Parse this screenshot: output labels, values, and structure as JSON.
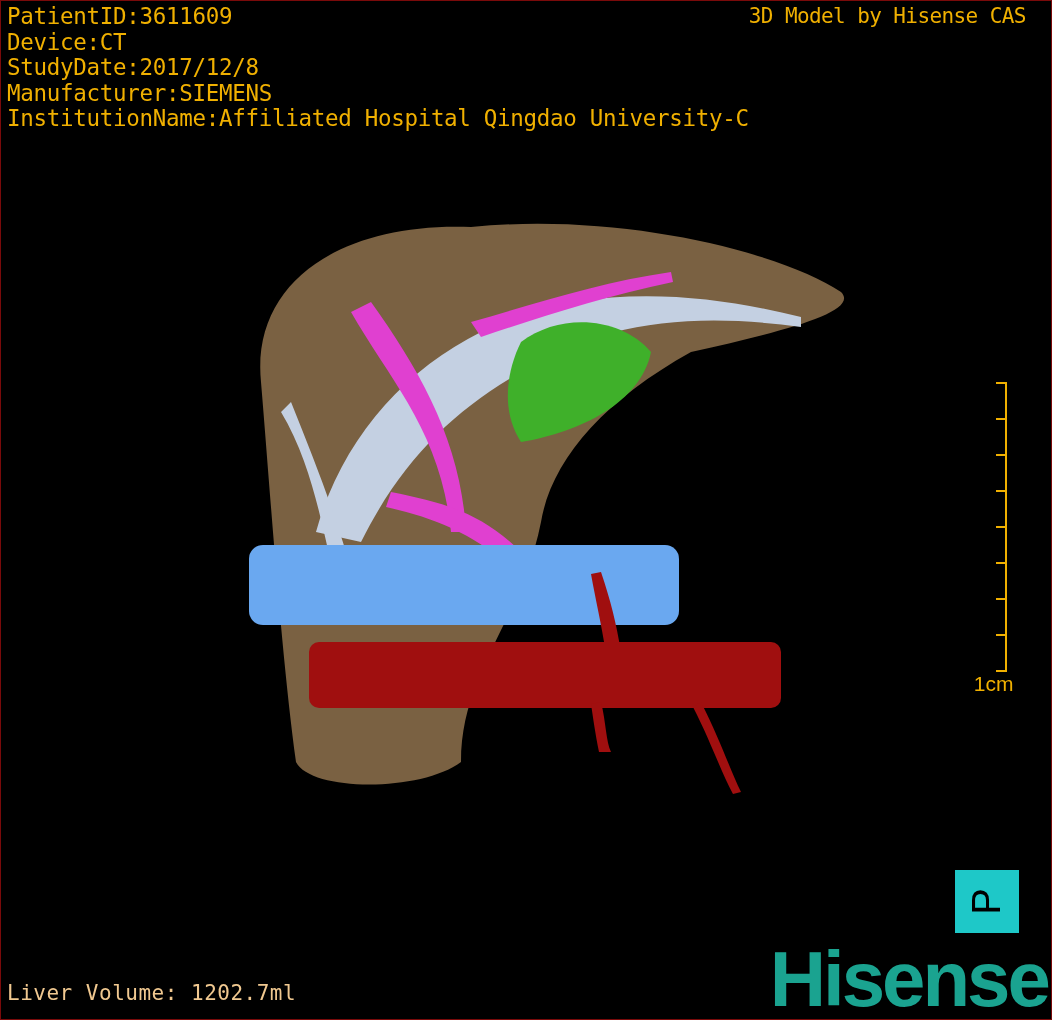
{
  "patient_info": [
    "PatientID:3611609",
    "Device:CT",
    "StudyDate:2017/12/8",
    "Manufacturer:SIEMENS",
    "InstitutionName:Affiliated Hospital Qingdao University-C"
  ],
  "title": "3D Model by Hisense CAS",
  "scale": {
    "label": "1cm"
  },
  "orientation_marker": "P",
  "liver_volume": "Liver Volume: 1202.7ml",
  "logo": "Hisense"
}
